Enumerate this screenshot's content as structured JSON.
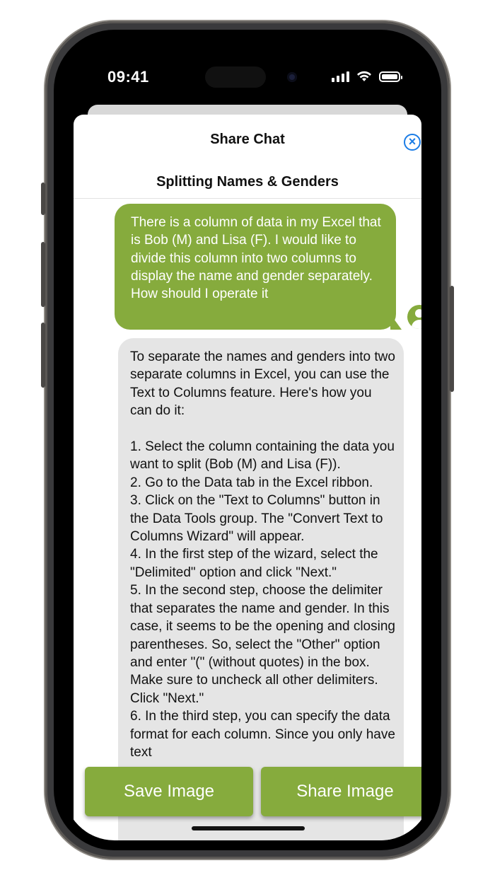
{
  "status_bar": {
    "time": "09:41"
  },
  "sheet": {
    "title": "Share Chat",
    "close_icon": "close-circle-icon",
    "chat_title": "Splitting Names & Genders"
  },
  "accent_color": "#86ab3d",
  "messages": {
    "user": "There is a column of data in my Excel that is Bob (M) and Lisa (F). I would like to divide this column into two columns to display the name and gender separately. How should I operate it",
    "assistant": "To separate the names and genders into two separate columns in Excel, you can use the Text to Columns feature. Here's how you can do it:\n\n1. Select the column containing the data you want to split (Bob (M) and Lisa (F)).\n2. Go to the Data tab in the Excel ribbon.\n3. Click on the \"Text to Columns\" button in the Data Tools group. The \"Convert Text to Columns Wizard\" will appear.\n4. In the first step of the wizard, select the \"Delimited\" option and click \"Next.\"\n5. In the second step, choose the delimiter that separates the name and gender. In this case, it seems to be the opening and closing parentheses. So, select the \"Other\" option and enter \"(\" (without quotes) in the box. Make sure to uncheck all other delimiters. Click \"Next.\"\n6. In the third step, you can specify the data format for each column. Since you only have text"
  },
  "actions": {
    "save_label": "Save Image",
    "share_label": "Share Image"
  }
}
